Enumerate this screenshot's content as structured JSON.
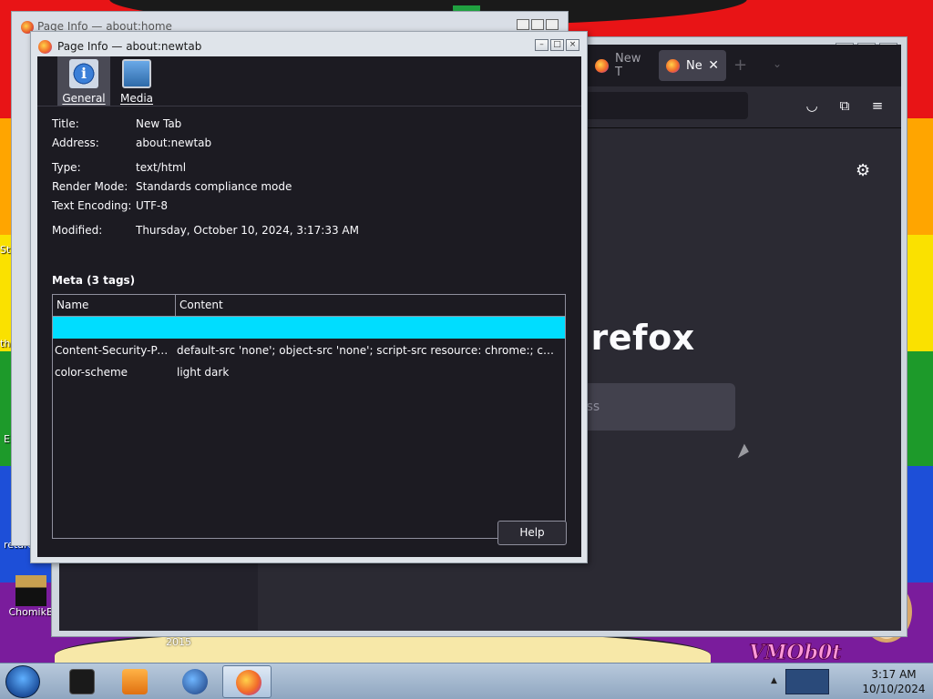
{
  "desktop": {
    "watermark": "VMOb0t",
    "year_text": "2015",
    "icons": [
      {
        "label": "ChomikB",
        "name": "desktop-icon-chomikb"
      }
    ],
    "edge_labels": [
      "retard",
      "St",
      "th",
      "E"
    ]
  },
  "back_window": {
    "title": "Page Info — about:home"
  },
  "firefox": {
    "tabs": [
      {
        "label": "New T",
        "active": false
      },
      {
        "label": "Ne",
        "active": true
      }
    ],
    "new_tab_glyph": "+",
    "list_all_glyph": "⌄",
    "wordmark": "irefox",
    "search_placeholder": "ess",
    "gear_glyph": "⚙",
    "pocket_glyph": "◡",
    "extensions_glyph": "⧉",
    "menu_glyph": "≡"
  },
  "page_info": {
    "title": "Page Info — about:newtab",
    "tabs": [
      {
        "label": "General",
        "selected": true
      },
      {
        "label": "Media",
        "selected": false
      }
    ],
    "fields": {
      "title_label": "Title:",
      "title_value": "New Tab",
      "address_label": "Address:",
      "address_value": "about:newtab",
      "type_label": "Type:",
      "type_value": "text/html",
      "render_mode_label": "Render Mode:",
      "render_mode_value": "Standards compliance mode",
      "encoding_label": "Text Encoding:",
      "encoding_value": "UTF-8",
      "modified_label": "Modified:",
      "modified_value": "Thursday, October 10, 2024, 3:17:33 AM"
    },
    "meta": {
      "heading": "Meta (3 tags)",
      "columns": {
        "name": "Name",
        "content": "Content"
      },
      "rows": [
        {
          "name": "",
          "content": "",
          "selected": true
        },
        {
          "name": "Content-Security-Polic...",
          "content": "default-src 'none'; object-src 'none'; script-src resource: chrome:; connect-src ..."
        },
        {
          "name": "color-scheme",
          "content": "light dark"
        }
      ]
    },
    "help_button": "Help"
  },
  "taskbar": {
    "clock_time": "3:17 AM",
    "clock_date": "10/10/2024"
  },
  "colors": {
    "selection": "#00ddff",
    "dialog_bg": "#1c1b22",
    "text": "#fbfbfe"
  }
}
